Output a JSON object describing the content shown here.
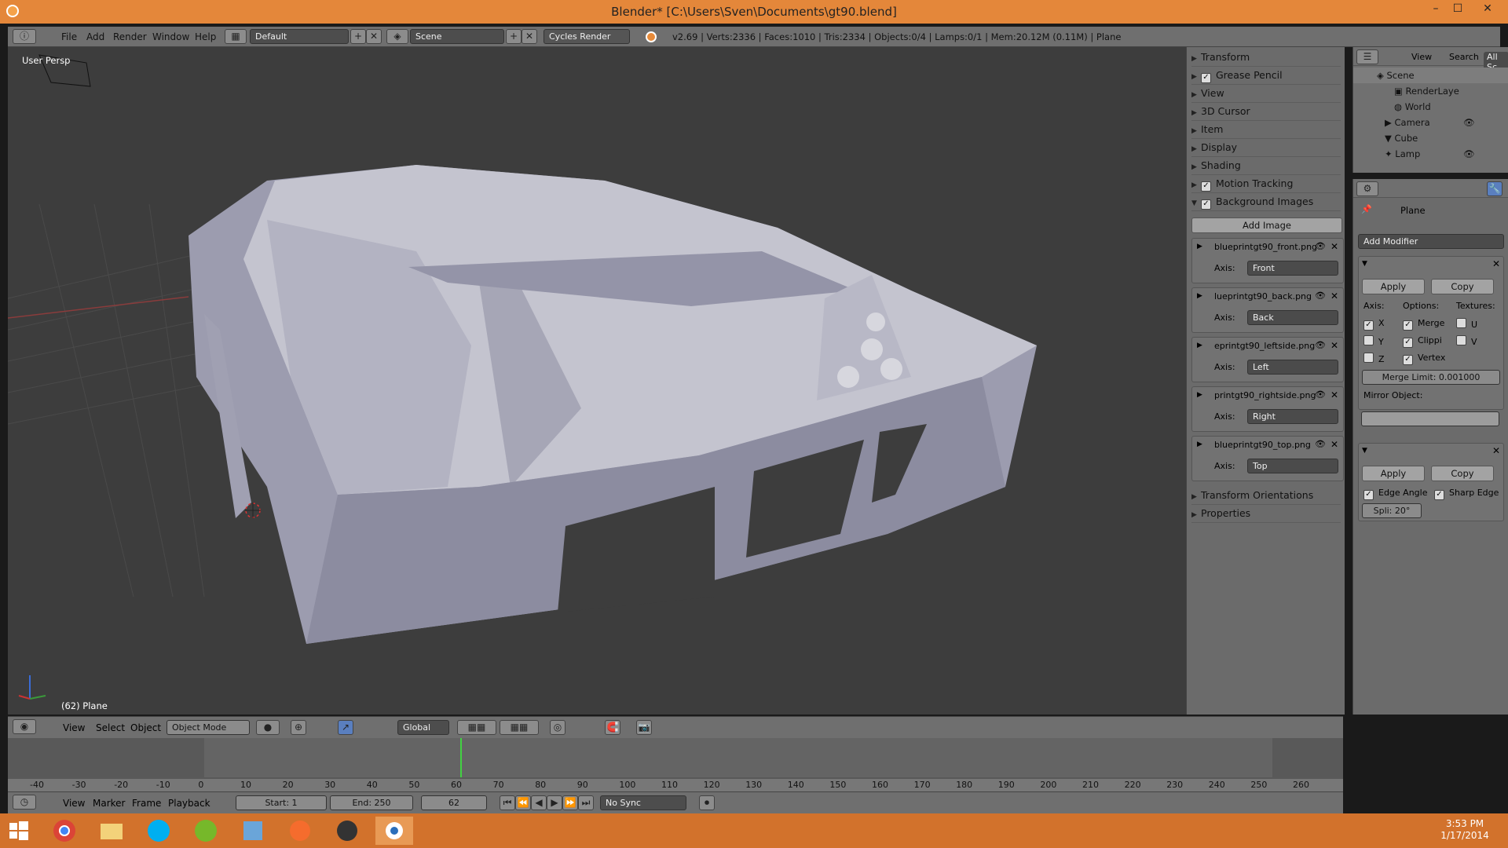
{
  "window": {
    "title": "Blender* [C:\\Users\\Sven\\Documents\\gt90.blend]",
    "min": "–",
    "max": "☐",
    "close": "✕"
  },
  "info": {
    "menus": [
      "File",
      "Add",
      "Render",
      "Window",
      "Help"
    ],
    "screen": "Default",
    "scene": "Scene",
    "engine": "Cycles Render",
    "stats": "v2.69 | Verts:2336 | Faces:1010 | Tris:2334 | Objects:0/4 | Lamps:0/1 | Mem:20.12M (0.11M) | Plane"
  },
  "viewport": {
    "view_label": "User Persp",
    "object_label": "(62) Plane"
  },
  "npanel": {
    "sections": [
      "Transform",
      "Grease Pencil",
      "View",
      "3D Cursor",
      "Item",
      "Display",
      "Shading",
      "Motion Tracking",
      "Background Images"
    ],
    "add_image": "Add Image",
    "axis_label": "Axis:",
    "images": [
      {
        "name": "blueprintgt90_front.png",
        "axis": "Front"
      },
      {
        "name": "lueprintgt90_back.png",
        "axis": "Back"
      },
      {
        "name": "eprintgt90_leftside.png",
        "axis": "Left"
      },
      {
        "name": "printgt90_rightside.png",
        "axis": "Right"
      },
      {
        "name": "blueprintgt90_top.png",
        "axis": "Top"
      }
    ],
    "after": [
      "Transform Orientations",
      "Properties"
    ]
  },
  "outliner": {
    "menus": [
      "View",
      "Search",
      "All Sc"
    ],
    "items": [
      "Scene",
      "RenderLaye",
      "World",
      "Camera",
      "Cube",
      "Lamp"
    ]
  },
  "props": {
    "object": "Plane",
    "add_modifier": "Add Modifier",
    "mirror": {
      "apply": "Apply",
      "copy": "Copy",
      "axis": "Axis:",
      "options": "Options:",
      "textures": "Textures:",
      "x": "X",
      "y": "Y",
      "z": "Z",
      "merge": "Merge",
      "clip": "Clippi",
      "vertex": "Vertex",
      "u": "U",
      "v": "V",
      "merge_limit": "Merge Limit: 0.001000",
      "mirror_object": "Mirror Object:"
    },
    "edgesplit": {
      "apply": "Apply",
      "copy": "Copy",
      "edge_angle": "Edge Angle",
      "sharp_edge": "Sharp Edge",
      "split": "Spli: 20°"
    }
  },
  "vheader": {
    "menus": [
      "View",
      "Select",
      "Object"
    ],
    "mode": "Object Mode",
    "orientation": "Global"
  },
  "timeline": {
    "ticks": [
      "-40",
      "-30",
      "-20",
      "-10",
      "0",
      "10",
      "20",
      "30",
      "40",
      "50",
      "60",
      "70",
      "80",
      "90",
      "100",
      "110",
      "120",
      "130",
      "140",
      "150",
      "160",
      "170",
      "180",
      "190",
      "200",
      "210",
      "220",
      "230",
      "240",
      "250",
      "260"
    ],
    "menus": [
      "View",
      "Marker",
      "Frame",
      "Playback"
    ],
    "start": "Start: 1",
    "end": "End: 250",
    "current": "62",
    "sync": "No Sync"
  },
  "taskbar": {
    "time": "3:53 PM",
    "date": "1/17/2014"
  }
}
